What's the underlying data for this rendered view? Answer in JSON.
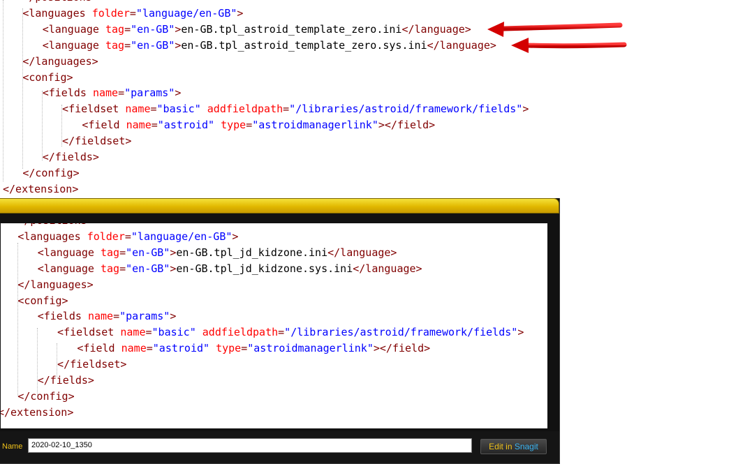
{
  "top_editor": {
    "lines": [
      {
        "i": 0,
        "indent": 2,
        "parts": [
          [
            "t",
            "</"
          ],
          [
            "t",
            "positions"
          ],
          [
            "t",
            ">"
          ]
        ]
      },
      {
        "i": 1,
        "indent": 2,
        "parts": [
          [
            "t",
            "<languages "
          ],
          [
            "a",
            "folder"
          ],
          [
            "t",
            "="
          ],
          [
            "v",
            "\"language/en-GB\""
          ],
          [
            "t",
            ">"
          ]
        ]
      },
      {
        "i": 2,
        "indent": 4,
        "parts": [
          [
            "t",
            "<language "
          ],
          [
            "a",
            "tag"
          ],
          [
            "t",
            "="
          ],
          [
            "v",
            "\"en-GB\""
          ],
          [
            "t",
            ">"
          ],
          [
            "x",
            "en-GB.tpl_astroid_template_zero.ini"
          ],
          [
            "t",
            "</language>"
          ]
        ]
      },
      {
        "i": 3,
        "indent": 4,
        "parts": [
          [
            "t",
            "<language "
          ],
          [
            "a",
            "tag"
          ],
          [
            "t",
            "="
          ],
          [
            "v",
            "\"en-GB\""
          ],
          [
            "t",
            ">"
          ],
          [
            "x",
            "en-GB.tpl_astroid_template_zero.sys.ini"
          ],
          [
            "t",
            "</language>"
          ]
        ]
      },
      {
        "i": 4,
        "indent": 2,
        "parts": [
          [
            "t",
            "</languages>"
          ]
        ]
      },
      {
        "i": 5,
        "indent": 2,
        "parts": [
          [
            "t",
            "<config>"
          ]
        ]
      },
      {
        "i": 6,
        "indent": 4,
        "parts": [
          [
            "t",
            "<fields "
          ],
          [
            "a",
            "name"
          ],
          [
            "t",
            "="
          ],
          [
            "v",
            "\"params\""
          ],
          [
            "t",
            ">"
          ]
        ]
      },
      {
        "i": 7,
        "indent": 6,
        "parts": [
          [
            "t",
            "<fieldset "
          ],
          [
            "a",
            "name"
          ],
          [
            "t",
            "="
          ],
          [
            "v",
            "\"basic\""
          ],
          [
            "t",
            " "
          ],
          [
            "a",
            "addfieldpath"
          ],
          [
            "t",
            "="
          ],
          [
            "v",
            "\"/libraries/astroid/framework/fields\""
          ],
          [
            "t",
            ">"
          ]
        ]
      },
      {
        "i": 8,
        "indent": 8,
        "parts": [
          [
            "t",
            "<field "
          ],
          [
            "a",
            "name"
          ],
          [
            "t",
            "="
          ],
          [
            "v",
            "\"astroid\""
          ],
          [
            "t",
            " "
          ],
          [
            "a",
            "type"
          ],
          [
            "t",
            "="
          ],
          [
            "v",
            "\"astroidmanagerlink\""
          ],
          [
            "t",
            "></field>"
          ]
        ]
      },
      {
        "i": 9,
        "indent": 6,
        "parts": [
          [
            "t",
            "</fieldset>"
          ]
        ]
      },
      {
        "i": 10,
        "indent": 4,
        "parts": [
          [
            "t",
            "</fields>"
          ]
        ]
      },
      {
        "i": 11,
        "indent": 2,
        "parts": [
          [
            "t",
            "</config>"
          ]
        ]
      },
      {
        "i": 12,
        "indent": 0,
        "parts": [
          [
            "t",
            "</extension>"
          ]
        ]
      }
    ]
  },
  "snagit_editor": {
    "lines": [
      {
        "i": 0,
        "indent": 2,
        "parts": [
          [
            "t",
            "</positions>"
          ]
        ]
      },
      {
        "i": 1,
        "indent": 2,
        "parts": [
          [
            "t",
            "<languages "
          ],
          [
            "a",
            "folder"
          ],
          [
            "t",
            "="
          ],
          [
            "v",
            "\"language/en-GB\""
          ],
          [
            "t",
            ">"
          ]
        ]
      },
      {
        "i": 2,
        "indent": 4,
        "parts": [
          [
            "t",
            "<language "
          ],
          [
            "a",
            "tag"
          ],
          [
            "t",
            "="
          ],
          [
            "v",
            "\"en-GB\""
          ],
          [
            "t",
            ">"
          ],
          [
            "x",
            "en-GB.tpl_jd_kidzone.ini"
          ],
          [
            "t",
            "</language>"
          ]
        ]
      },
      {
        "i": 3,
        "indent": 4,
        "parts": [
          [
            "t",
            "<language "
          ],
          [
            "a",
            "tag"
          ],
          [
            "t",
            "="
          ],
          [
            "v",
            "\"en-GB\""
          ],
          [
            "t",
            ">"
          ],
          [
            "x",
            "en-GB.tpl_jd_kidzone.sys.ini"
          ],
          [
            "t",
            "</language>"
          ]
        ]
      },
      {
        "i": 4,
        "indent": 2,
        "parts": [
          [
            "t",
            "</languages>"
          ]
        ]
      },
      {
        "i": 5,
        "indent": 2,
        "parts": [
          [
            "t",
            "<config>"
          ]
        ]
      },
      {
        "i": 6,
        "indent": 4,
        "parts": [
          [
            "t",
            "<fields "
          ],
          [
            "a",
            "name"
          ],
          [
            "t",
            "="
          ],
          [
            "v",
            "\"params\""
          ],
          [
            "t",
            ">"
          ]
        ]
      },
      {
        "i": 7,
        "indent": 6,
        "parts": [
          [
            "t",
            "<fieldset "
          ],
          [
            "a",
            "name"
          ],
          [
            "t",
            "="
          ],
          [
            "v",
            "\"basic\""
          ],
          [
            "t",
            " "
          ],
          [
            "a",
            "addfieldpath"
          ],
          [
            "t",
            "="
          ],
          [
            "v",
            "\"/libraries/astroid/framework/fields\""
          ],
          [
            "t",
            ">"
          ]
        ]
      },
      {
        "i": 8,
        "indent": 8,
        "parts": [
          [
            "t",
            "<field "
          ],
          [
            "a",
            "name"
          ],
          [
            "t",
            "="
          ],
          [
            "v",
            "\"astroid\""
          ],
          [
            "t",
            " "
          ],
          [
            "a",
            "type"
          ],
          [
            "t",
            "="
          ],
          [
            "v",
            "\"astroidmanagerlink\""
          ],
          [
            "t",
            "></field>"
          ]
        ]
      },
      {
        "i": 9,
        "indent": 6,
        "parts": [
          [
            "t",
            "</fieldset>"
          ]
        ]
      },
      {
        "i": 10,
        "indent": 4,
        "parts": [
          [
            "t",
            "</fields>"
          ]
        ]
      },
      {
        "i": 11,
        "indent": 2,
        "parts": [
          [
            "t",
            "</config>"
          ]
        ]
      },
      {
        "i": 12,
        "indent": 0,
        "parts": [
          [
            "t",
            "</extension>"
          ]
        ]
      }
    ]
  },
  "snagit_footer": {
    "name_label": "Name",
    "name_value": "2020-02-10_1350",
    "edit_in_label": "Edit in ",
    "snagit_label": "Snagit"
  },
  "colors": {
    "tag": "#800000",
    "attribute": "#ff0000",
    "value": "#0000ff",
    "arrow": "#e00000",
    "snagit_gold": "#f0c21b"
  },
  "icons": [
    "red-arrow-icon",
    "red-arrow-icon"
  ]
}
